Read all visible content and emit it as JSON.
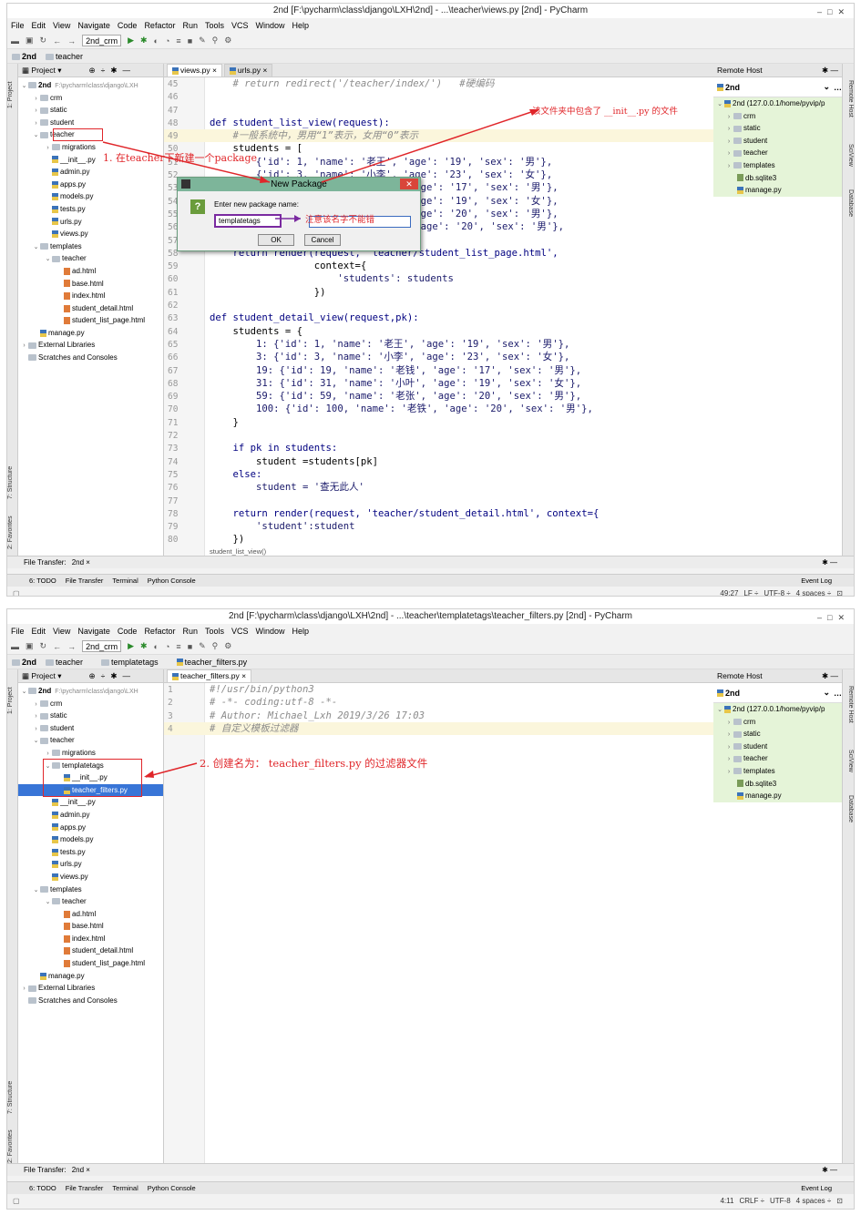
{
  "colors": {
    "accent": "#3875d7",
    "annotation": "#e0262a",
    "remote_bg": "#e5f4d8",
    "highlight_line": "#fbf6dc"
  },
  "menu": [
    "File",
    "Edit",
    "View",
    "Navigate",
    "Code",
    "Refactor",
    "Run",
    "Tools",
    "VCS",
    "Window",
    "Help"
  ],
  "toolbar": {
    "run_config": "2nd_crm"
  },
  "panel": {
    "project_label": "Project",
    "remote_label": "Remote Host",
    "remote_server": "2nd"
  },
  "left_tabs": [
    "1: Project",
    "7: Structure",
    "2: Favorites"
  ],
  "right_tabs": [
    "Remote Host",
    "SciView",
    "Database"
  ],
  "bottom_tabs": [
    "6: TODO",
    "File Transfer",
    "Terminal",
    "Python Console"
  ],
  "event_log": "Event Log",
  "file_transfer": {
    "label": "File Transfer:",
    "tab": "2nd"
  },
  "remote_tree": [
    {
      "label": "2nd (127.0.0.1/home/pyvip/p",
      "kind": "root"
    },
    {
      "label": "crm",
      "kind": "folder"
    },
    {
      "label": "static",
      "kind": "folder"
    },
    {
      "label": "student",
      "kind": "folder"
    },
    {
      "label": "teacher",
      "kind": "folder"
    },
    {
      "label": "templates",
      "kind": "folder"
    },
    {
      "label": "db.sqlite3",
      "kind": "db"
    },
    {
      "label": "manage.py",
      "kind": "py"
    }
  ],
  "window1": {
    "title": "2nd [F:\\pycharm\\class\\django\\LXH\\2nd] - ...\\teacher\\views.py [2nd] - PyCharm",
    "nav": [
      "2nd",
      "teacher"
    ],
    "tabs": [
      "views.py",
      "urls.py"
    ],
    "tree": [
      {
        "label": "2nd",
        "note": "F:\\pycharm\\class\\django\\LXH",
        "indent": 0,
        "arrow": "v",
        "kind": "folder"
      },
      {
        "label": "crm",
        "indent": 1,
        "arrow": ">",
        "kind": "folder"
      },
      {
        "label": "static",
        "indent": 1,
        "arrow": ">",
        "kind": "folder"
      },
      {
        "label": "student",
        "indent": 1,
        "arrow": ">",
        "kind": "folder"
      },
      {
        "label": "teacher",
        "indent": 1,
        "arrow": "v",
        "kind": "folder"
      },
      {
        "label": "migrations",
        "indent": 2,
        "arrow": ">",
        "kind": "folder"
      },
      {
        "label": "__init__.py",
        "indent": 2,
        "arrow": "",
        "kind": "py"
      },
      {
        "label": "admin.py",
        "indent": 2,
        "arrow": "",
        "kind": "py"
      },
      {
        "label": "apps.py",
        "indent": 2,
        "arrow": "",
        "kind": "py"
      },
      {
        "label": "models.py",
        "indent": 2,
        "arrow": "",
        "kind": "py"
      },
      {
        "label": "tests.py",
        "indent": 2,
        "arrow": "",
        "kind": "py"
      },
      {
        "label": "urls.py",
        "indent": 2,
        "arrow": "",
        "kind": "py"
      },
      {
        "label": "views.py",
        "indent": 2,
        "arrow": "",
        "kind": "py"
      },
      {
        "label": "templates",
        "indent": 1,
        "arrow": "v",
        "kind": "folder"
      },
      {
        "label": "teacher",
        "indent": 2,
        "arrow": "v",
        "kind": "folder"
      },
      {
        "label": "ad.html",
        "indent": 3,
        "arrow": "",
        "kind": "html"
      },
      {
        "label": "base.html",
        "indent": 3,
        "arrow": "",
        "kind": "html"
      },
      {
        "label": "index.html",
        "indent": 3,
        "arrow": "",
        "kind": "html"
      },
      {
        "label": "student_detail.html",
        "indent": 3,
        "arrow": "",
        "kind": "html"
      },
      {
        "label": "student_list_page.html",
        "indent": 3,
        "arrow": "",
        "kind": "html"
      },
      {
        "label": "manage.py",
        "indent": 1,
        "arrow": "",
        "kind": "py"
      },
      {
        "label": "External Libraries",
        "indent": 0,
        "arrow": ">",
        "kind": "lib"
      },
      {
        "label": "Scratches and Consoles",
        "indent": 0,
        "arrow": "",
        "kind": "scratch"
      }
    ],
    "code": [
      {
        "n": "45",
        "t": "    # return redirect('/teacher/index/')   #硬编码",
        "c": "cm"
      },
      {
        "n": "46",
        "t": "",
        "c": ""
      },
      {
        "n": "47",
        "t": "",
        "c": ""
      },
      {
        "n": "48",
        "t": "def student_list_view(request):",
        "c": "def"
      },
      {
        "n": "49",
        "t": "    #一般系统中，男用“1”表示，女用“0”表示",
        "c": "cm",
        "hl": true
      },
      {
        "n": "50",
        "t": "    students = [",
        "c": ""
      },
      {
        "n": "51",
        "t": "        {'id': 1, 'name': '老王', 'age': '19', 'sex': '男'},",
        "c": "d"
      },
      {
        "n": "52",
        "t": "        {'id': 3, 'name': '小李', 'age': '23', 'sex': '女'},",
        "c": "d"
      },
      {
        "n": "53",
        "t": "        {'id': 19, 'name': '老钱', 'age': '17', 'sex': '男'},",
        "c": "d"
      },
      {
        "n": "54",
        "t": "        {'id': 31, 'name': '小叶', 'age': '19', 'sex': '女'},",
        "c": "d"
      },
      {
        "n": "55",
        "t": "        {'id': 59, 'name': '老张', 'age': '20', 'sex': '男'},",
        "c": "d"
      },
      {
        "n": "56",
        "t": "        {'id': 100, 'name': '老铁', 'age': '20', 'sex': '男'},",
        "c": "d"
      },
      {
        "n": "57",
        "t": "    ]",
        "c": ""
      },
      {
        "n": "58",
        "t": "    return render(request, 'teacher/student_list_page.html',",
        "c": "ret"
      },
      {
        "n": "59",
        "t": "                  context={",
        "c": ""
      },
      {
        "n": "60",
        "t": "                      'students': students",
        "c": "d"
      },
      {
        "n": "61",
        "t": "                  })",
        "c": ""
      },
      {
        "n": "62",
        "t": "",
        "c": ""
      },
      {
        "n": "63",
        "t": "def student_detail_view(request,pk):",
        "c": "def"
      },
      {
        "n": "64",
        "t": "    students = {",
        "c": ""
      },
      {
        "n": "65",
        "t": "        1: {'id': 1, 'name': '老王', 'age': '19', 'sex': '男'},",
        "c": "d"
      },
      {
        "n": "66",
        "t": "        3: {'id': 3, 'name': '小李', 'age': '23', 'sex': '女'},",
        "c": "d"
      },
      {
        "n": "67",
        "t": "        19: {'id': 19, 'name': '老钱', 'age': '17', 'sex': '男'},",
        "c": "d"
      },
      {
        "n": "68",
        "t": "        31: {'id': 31, 'name': '小叶', 'age': '19', 'sex': '女'},",
        "c": "d"
      },
      {
        "n": "69",
        "t": "        59: {'id': 59, 'name': '老张', 'age': '20', 'sex': '男'},",
        "c": "d"
      },
      {
        "n": "70",
        "t": "        100: {'id': 100, 'name': '老铁', 'age': '20', 'sex': '男'},",
        "c": "d"
      },
      {
        "n": "71",
        "t": "    }",
        "c": ""
      },
      {
        "n": "72",
        "t": "",
        "c": ""
      },
      {
        "n": "73",
        "t": "    if pk in students:",
        "c": "kw"
      },
      {
        "n": "74",
        "t": "        student =students[pk]",
        "c": ""
      },
      {
        "n": "75",
        "t": "    else:",
        "c": "kw"
      },
      {
        "n": "76",
        "t": "        student = '查无此人'",
        "c": "d"
      },
      {
        "n": "77",
        "t": "",
        "c": ""
      },
      {
        "n": "78",
        "t": "    return render(request, 'teacher/student_detail.html', context={",
        "c": "ret"
      },
      {
        "n": "79",
        "t": "        'student':student",
        "c": "d"
      },
      {
        "n": "80",
        "t": "    })",
        "c": ""
      }
    ],
    "breadcrumb": "student_list_view()",
    "status": [
      "49:27",
      "LF ÷",
      "UTF-8 ÷",
      "4 spaces ÷"
    ],
    "dialog": {
      "title": "New Package",
      "prompt": "Enter new package name:",
      "value": "templatetags",
      "ok": "OK",
      "cancel": "Cancel"
    },
    "annotations": {
      "step1": "1. 在teacher下新建一个package",
      "init_note": "该文件夹中包含了 __init__.py 的文件",
      "name_note": "注意该名字不能错"
    }
  },
  "window2": {
    "title": "2nd [F:\\pycharm\\class\\django\\LXH\\2nd] - ...\\teacher\\templatetags\\teacher_filters.py [2nd] - PyCharm",
    "nav": [
      "2nd",
      "teacher",
      "templatetags",
      "teacher_filters.py"
    ],
    "tabs": [
      "teacher_filters.py"
    ],
    "tree": [
      {
        "label": "2nd",
        "note": "F:\\pycharm\\class\\django\\LXH",
        "indent": 0,
        "arrow": "v",
        "kind": "folder"
      },
      {
        "label": "crm",
        "indent": 1,
        "arrow": ">",
        "kind": "folder"
      },
      {
        "label": "static",
        "indent": 1,
        "arrow": ">",
        "kind": "folder"
      },
      {
        "label": "student",
        "indent": 1,
        "arrow": ">",
        "kind": "folder"
      },
      {
        "label": "teacher",
        "indent": 1,
        "arrow": "v",
        "kind": "folder"
      },
      {
        "label": "migrations",
        "indent": 2,
        "arrow": ">",
        "kind": "folder"
      },
      {
        "label": "templatetags",
        "indent": 2,
        "arrow": "v",
        "kind": "folder"
      },
      {
        "label": "__init__.py",
        "indent": 3,
        "arrow": "",
        "kind": "py"
      },
      {
        "label": "teacher_filters.py",
        "indent": 3,
        "arrow": "",
        "kind": "py",
        "selected": true
      },
      {
        "label": "__init__.py",
        "indent": 2,
        "arrow": "",
        "kind": "py"
      },
      {
        "label": "admin.py",
        "indent": 2,
        "arrow": "",
        "kind": "py"
      },
      {
        "label": "apps.py",
        "indent": 2,
        "arrow": "",
        "kind": "py"
      },
      {
        "label": "models.py",
        "indent": 2,
        "arrow": "",
        "kind": "py"
      },
      {
        "label": "tests.py",
        "indent": 2,
        "arrow": "",
        "kind": "py"
      },
      {
        "label": "urls.py",
        "indent": 2,
        "arrow": "",
        "kind": "py"
      },
      {
        "label": "views.py",
        "indent": 2,
        "arrow": "",
        "kind": "py"
      },
      {
        "label": "templates",
        "indent": 1,
        "arrow": "v",
        "kind": "folder"
      },
      {
        "label": "teacher",
        "indent": 2,
        "arrow": "v",
        "kind": "folder"
      },
      {
        "label": "ad.html",
        "indent": 3,
        "arrow": "",
        "kind": "html"
      },
      {
        "label": "base.html",
        "indent": 3,
        "arrow": "",
        "kind": "html"
      },
      {
        "label": "index.html",
        "indent": 3,
        "arrow": "",
        "kind": "html"
      },
      {
        "label": "student_detail.html",
        "indent": 3,
        "arrow": "",
        "kind": "html"
      },
      {
        "label": "student_list_page.html",
        "indent": 3,
        "arrow": "",
        "kind": "html"
      },
      {
        "label": "manage.py",
        "indent": 1,
        "arrow": "",
        "kind": "py"
      },
      {
        "label": "External Libraries",
        "indent": 0,
        "arrow": ">",
        "kind": "lib"
      },
      {
        "label": "Scratches and Consoles",
        "indent": 0,
        "arrow": "",
        "kind": "scratch"
      }
    ],
    "code": [
      {
        "n": "1",
        "t": "#!/usr/bin/python3",
        "c": "cm"
      },
      {
        "n": "2",
        "t": "# -*- coding:utf-8 -*-",
        "c": "cm"
      },
      {
        "n": "3",
        "t": "# Author: Michael_Lxh 2019/3/26 17:03",
        "c": "cm"
      },
      {
        "n": "4",
        "t": "# 自定义模板过滤器",
        "c": "cm",
        "hl": true
      }
    ],
    "status": [
      "4:11",
      "CRLF ÷",
      "UTF-8",
      "4 spaces ÷"
    ],
    "annotations": {
      "step2": "2. 创建名为： teacher_filters.py 的过滤器文件"
    }
  }
}
